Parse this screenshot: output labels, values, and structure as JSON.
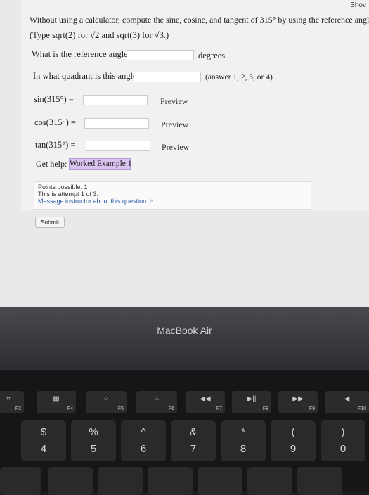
{
  "header": {
    "show_label": "Shov"
  },
  "question": {
    "prompt": "Without using a calculator, compute the sine, cosine, and tangent of 315° by using the reference angle.",
    "hint": "(Type sqrt(2) for √2 and sqrt(3) for √3.)",
    "ref_angle_label": "What is the reference angle?",
    "ref_angle_unit": "degrees.",
    "quadrant_label": "In what quadrant is this angle?",
    "quadrant_hint": "(answer 1, 2, 3, or 4)",
    "sin_label": "sin(315°) =",
    "cos_label": "cos(315°) =",
    "tan_label": "tan(315°) =",
    "preview_label": "Preview",
    "help_label": "Get help:",
    "worked_example_label": "Worked Example 1"
  },
  "info": {
    "points": "Points possible: 1",
    "attempt": "This is attempt 1 of 3.",
    "message": "Message instructor about this question"
  },
  "submit_label": "Submit",
  "laptop": {
    "brand": "MacBook Air"
  },
  "keyboard": {
    "fkeys": [
      {
        "label": "F3",
        "glyph": "⌗"
      },
      {
        "label": "F4",
        "glyph": "▦"
      },
      {
        "label": "F5",
        "glyph": "⁘"
      },
      {
        "label": "F6",
        "glyph": "⁙"
      },
      {
        "label": "F7",
        "glyph": "◀◀"
      },
      {
        "label": "F8",
        "glyph": "▶||"
      },
      {
        "label": "F9",
        "glyph": "▶▶"
      },
      {
        "label": "F10",
        "glyph": "◀"
      }
    ],
    "numkeys": [
      {
        "top": "$",
        "bottom": "4"
      },
      {
        "top": "%",
        "bottom": "5"
      },
      {
        "top": "^",
        "bottom": "6"
      },
      {
        "top": "&",
        "bottom": "7"
      },
      {
        "top": "*",
        "bottom": "8"
      },
      {
        "top": "(",
        "bottom": "9"
      },
      {
        "top": ")",
        "bottom": "0"
      }
    ]
  }
}
